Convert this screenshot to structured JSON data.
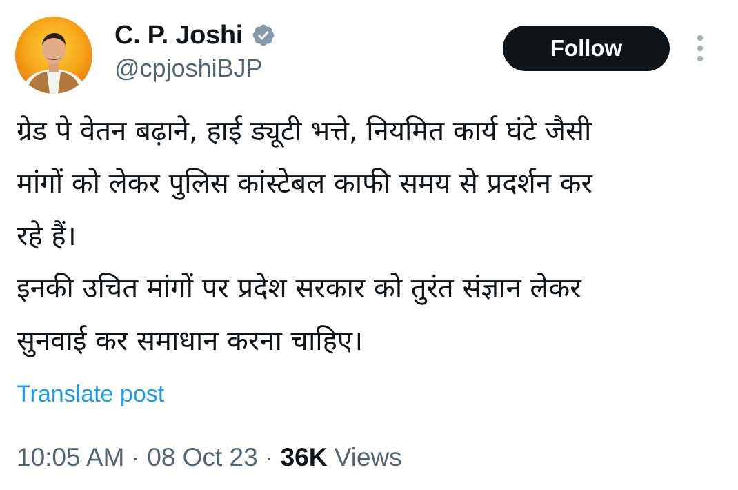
{
  "author": {
    "display_name": "C. P. Joshi",
    "handle": "@cpjoshiBJP",
    "verified_icon": "verified-badge-icon",
    "avatar": "profile-photo"
  },
  "actions": {
    "follow_label": "Follow",
    "more_icon": "more-vertical-icon"
  },
  "post": {
    "lines": [
      "ग्रेड पे वेतन बढ़ाने, हाई ड्यूटी भत्ते, नियमित कार्य घंटे जैसी",
      "मांगों को लेकर पुलिस कांस्टेबल काफी समय से प्रदर्शन कर",
      "रहे हैं।",
      "इनकी उचित मांगों पर प्रदेश सरकार को तुरंत संज्ञान लेकर",
      "सुनवाई कर समाधान करना चाहिए।"
    ],
    "translate_label": "Translate post"
  },
  "meta": {
    "time": "10:05 AM",
    "separator": " · ",
    "date": "08 Oct 23",
    "views_count": "36K",
    "views_label": "Views"
  },
  "colors": {
    "text_primary": "#0f1419",
    "text_secondary": "#536471",
    "link": "#1d9bf0",
    "follow_bg": "#0f1419",
    "verified_badge": "#829aab"
  }
}
